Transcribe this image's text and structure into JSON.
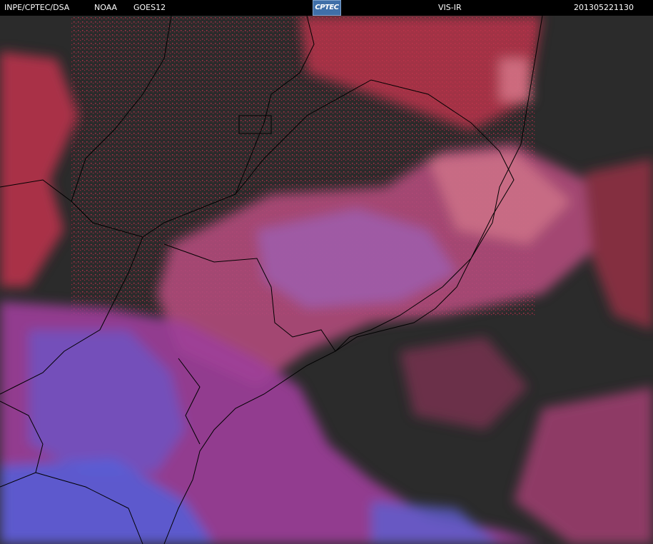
{
  "header": {
    "agency": "INPE/CPTEC/DSA",
    "source": "NOAA",
    "satellite": "GOES12",
    "logo_text": "CPTEC",
    "product": "VIS-IR",
    "timestamp": "201305221130"
  },
  "colors": {
    "background": "#2b2b2b",
    "header": "#000000",
    "cloud_red": "#c0344e",
    "cloud_magenta": "#9d3f9a",
    "cloud_blue": "#5560d8",
    "cloud_pink": "#d77a8c",
    "borders": "#000000"
  },
  "imagery": {
    "type": "satellite-composite",
    "region": "southeastern-south-america"
  }
}
